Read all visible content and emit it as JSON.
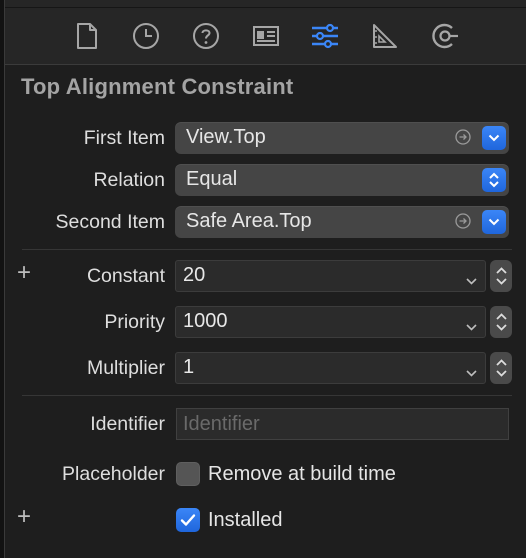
{
  "toolbar": {
    "icons": [
      "file-icon",
      "history-icon",
      "help-icon",
      "identity-icon",
      "attributes-icon",
      "size-icon",
      "connections-icon"
    ],
    "active_index": 4,
    "accent": "#3b86f7"
  },
  "section": {
    "title": "Top Alignment Constraint"
  },
  "first_item": {
    "label": "First Item",
    "value": "View.Top"
  },
  "relation": {
    "label": "Relation",
    "value": "Equal"
  },
  "second_item": {
    "label": "Second Item",
    "value": "Safe Area.Top"
  },
  "constant": {
    "label": "Constant",
    "value": "20"
  },
  "priority": {
    "label": "Priority",
    "value": "1000"
  },
  "multiplier": {
    "label": "Multiplier",
    "value": "1"
  },
  "identifier": {
    "label": "Identifier",
    "placeholder": "Identifier",
    "value": ""
  },
  "placeholder": {
    "label": "Placeholder",
    "checkbox_label": "Remove at build time",
    "checked": false
  },
  "installed": {
    "label": "Installed",
    "checked": true
  },
  "add_glyph": "+"
}
